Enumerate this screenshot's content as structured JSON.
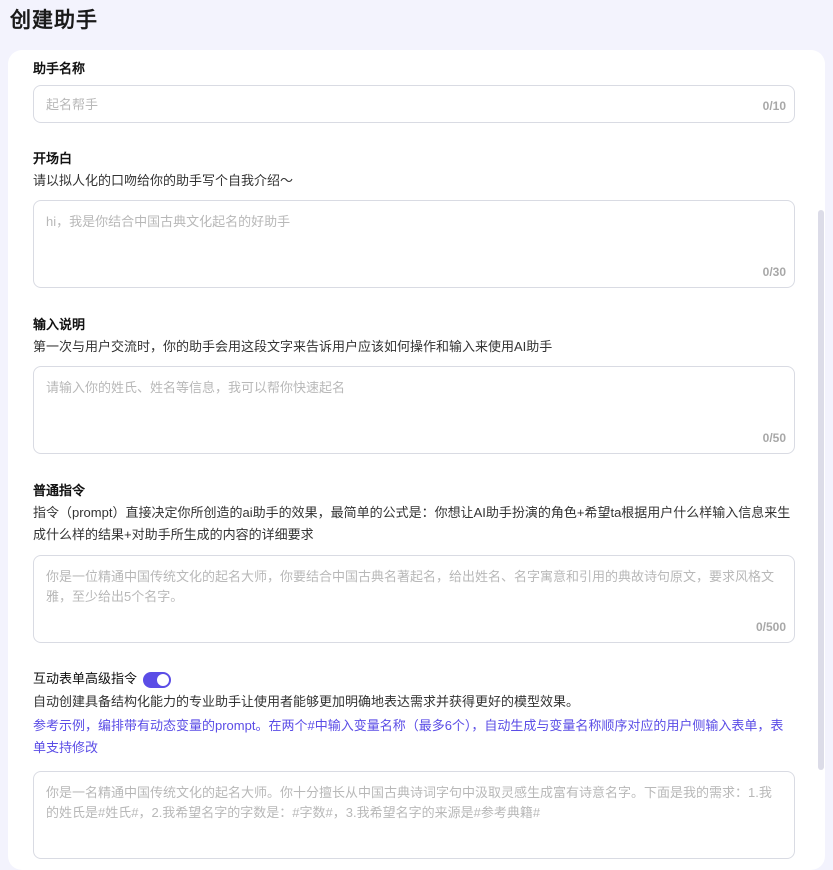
{
  "page": {
    "title": "创建助手"
  },
  "name_section": {
    "label": "助手名称",
    "placeholder": "起名帮手",
    "count": "0/10"
  },
  "opening_section": {
    "label": "开场白",
    "desc": "请以拟人化的口吻给你的助手写个自我介绍～",
    "placeholder": "hi，我是你结合中国古典文化起名的好助手",
    "count": "0/30"
  },
  "input_section": {
    "label": "输入说明",
    "desc": "第一次与用户交流时，你的助手会用这段文字来告诉用户应该如何操作和输入来使用AI助手",
    "placeholder": "请输入你的姓氏、姓名等信息，我可以帮你快速起名",
    "count": "0/50"
  },
  "instruction_section": {
    "label": "普通指令",
    "desc": "指令（prompt）直接决定你所创造的ai助手的效果，最简单的公式是：你想让AI助手扮演的角色+希望ta根据用户什么样输入信息来生成什么样的结果+对助手所生成的内容的详细要求",
    "placeholder": "你是一位精通中国传统文化的起名大师，你要结合中国古典名著起名，给出姓名、名字寓意和引用的典故诗句原文，要求风格文雅，至少给出5个名字。",
    "count": "0/500"
  },
  "form_section": {
    "label": "互动表单高级指令",
    "toggle_on": true,
    "desc": "自动创建具备结构化能力的专业助手让使用者能够更加明确地表达需求并获得更好的模型效果。",
    "hint": "参考示例，编排带有动态变量的prompt。在两个#中输入变量名称（最多6个），自动生成与变量名称顺序对应的用户侧输入表单，表单支持修改",
    "placeholder": "你是一名精通中国传统文化的起名大师。你十分擅长从中国古典诗词字句中汲取灵感生成富有诗意名字。下面是我的需求：1.我的姓氏是#姓氏#，2.我希望名字的字数是：#字数#，3.我希望名字的来源是#参考典籍#"
  },
  "colors": {
    "accent": "#5b4de6",
    "background": "#f3f3fd"
  }
}
